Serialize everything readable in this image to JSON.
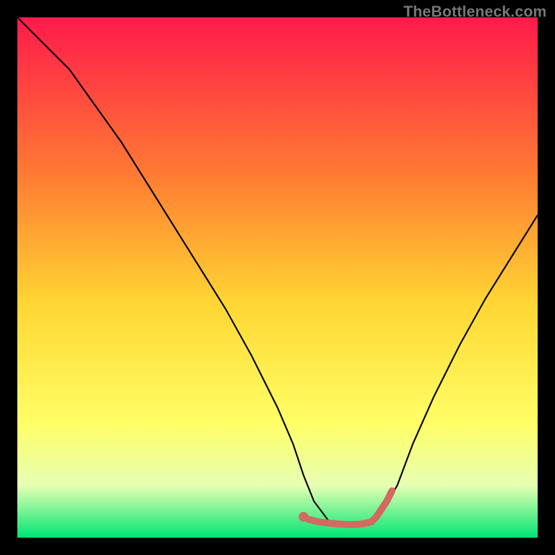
{
  "watermark": "TheBottleneck.com",
  "chart_data": {
    "type": "line",
    "title": "",
    "xlabel": "",
    "ylabel": "",
    "xlim": [
      0,
      100
    ],
    "ylim": [
      0,
      100
    ],
    "grid": false,
    "legend": false,
    "background_gradient": {
      "top": "#ff1a4b",
      "mid_upper": "#ff7a33",
      "mid": "#ffd633",
      "mid_lower": "#ffff66",
      "light": "#e6ffb3",
      "bottom": "#00e673"
    },
    "series": [
      {
        "name": "bottleneck-curve",
        "color": "#000000",
        "x": [
          0,
          2,
          5,
          10,
          15,
          20,
          25,
          30,
          35,
          40,
          45,
          50,
          53,
          55,
          57,
          60,
          64,
          68,
          70,
          73,
          76,
          80,
          85,
          90,
          95,
          100
        ],
        "y": [
          100,
          98,
          95,
          90,
          83,
          76,
          68,
          60,
          52,
          44,
          35,
          25,
          18,
          12,
          7,
          3,
          2,
          3,
          5,
          10,
          18,
          27,
          37,
          46,
          54,
          62
        ]
      },
      {
        "name": "optimal-region-marker",
        "color": "#d16a5f",
        "x": [
          55,
          56,
          58,
          60,
          62,
          64,
          66,
          68,
          69,
          70,
          71,
          72
        ],
        "y": [
          4,
          3.5,
          3,
          2.8,
          2.6,
          2.5,
          2.6,
          3,
          4,
          5.5,
          7,
          9
        ]
      }
    ],
    "markers": [
      {
        "name": "optimal-dot",
        "x": 55,
        "y": 4,
        "color": "#d16a5f",
        "size": 7
      }
    ]
  }
}
